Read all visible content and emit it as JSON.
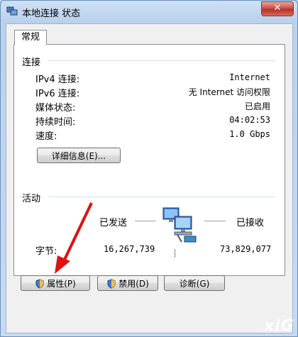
{
  "window": {
    "title": "本地连接 状态",
    "close_label": "✕"
  },
  "tab": {
    "label": "常规"
  },
  "connection": {
    "heading": "连接",
    "rows": [
      {
        "label": "IPv4 连接:",
        "value": "Internet"
      },
      {
        "label": "IPv6 连接:",
        "value": "无 Internet 访问权限"
      },
      {
        "label": "媒体状态:",
        "value": "已启用"
      },
      {
        "label": "持续时间:",
        "value": "04:02:53"
      },
      {
        "label": "速度:",
        "value": "1.0 Gbps"
      }
    ],
    "details_button": "详细信息(E)..."
  },
  "activity": {
    "heading": "活动",
    "sent_label": "已发送",
    "received_label": "已接收",
    "bytes_label": "字节:",
    "bytes_sent": "16,267,739",
    "bytes_received": "73,829,077"
  },
  "buttons": {
    "properties": "属性(P)",
    "disable": "禁用(D)",
    "diagnose": "诊断(G)"
  },
  "watermark": "xiG"
}
